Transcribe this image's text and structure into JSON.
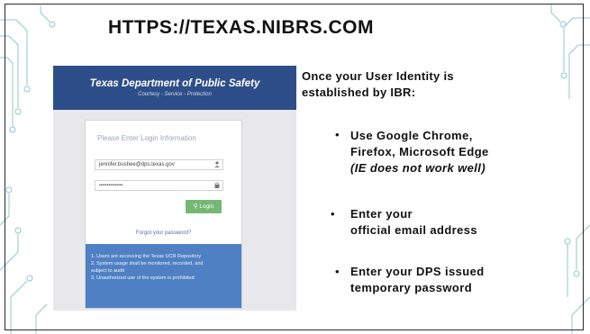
{
  "slide": {
    "title": "HTTPS://TEXAS.NIBRS.COM"
  },
  "login_screenshot": {
    "header_title": "Texas Department of Public Safety",
    "header_subtitle": "Courtesy  -  Service  -  Protection",
    "login_heading": "Please Enter Login Information",
    "email_value": "jennifer.bushee@dps.texas.gov",
    "password_value": "•••••••••••••••",
    "login_button": "Login",
    "forgot_link": "Forgot your password?",
    "notice_lines": [
      "1. Users are accessing the Texas UCR Repository",
      "2. System usage shall be monitored, recorded, and",
      "subject to audit",
      "3. Unauthorized use of the system is prohibited"
    ]
  },
  "instructions": {
    "intro_line1": "Once your User Identity is",
    "intro_line2": "established by IBR:",
    "bullets": [
      {
        "line1": "Use Google Chrome,",
        "line2": "Firefox,  Microsoft Edge",
        "line3": "(IE does not work well)"
      },
      {
        "line1": "Enter your",
        "line2": "official email address"
      },
      {
        "line1": "Enter your DPS issued",
        "line2": "temporary password"
      }
    ]
  },
  "colors": {
    "header_blue": "#2d4e88",
    "notice_blue": "#4f80c4",
    "login_green": "#74b874",
    "circuit_teal": "#8ec9cf"
  },
  "icons": {
    "bullet": "•",
    "user_field": "user-icon",
    "password_field": "lock-icon",
    "login_button": "key-icon"
  }
}
